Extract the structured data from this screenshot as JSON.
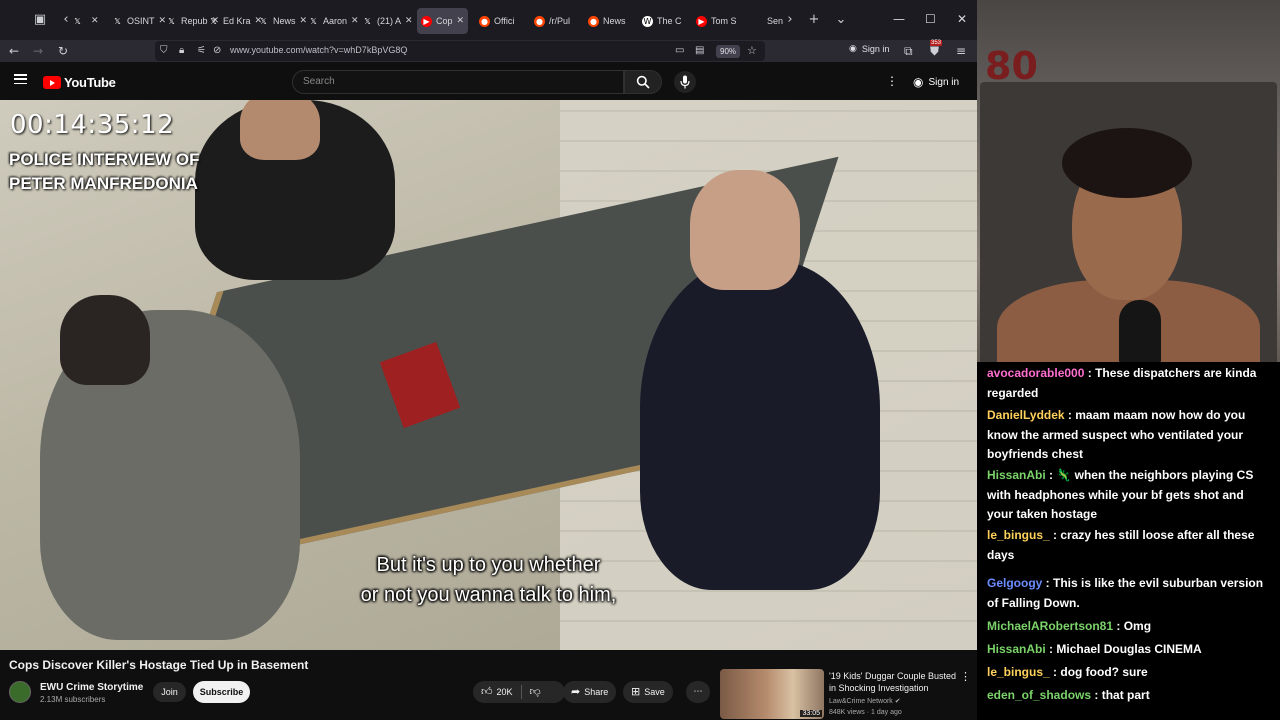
{
  "browser": {
    "tabs": [
      {
        "label": "",
        "icon": "x-logo-icon"
      },
      {
        "label": "OSINT",
        "icon": "x-logo-icon"
      },
      {
        "label": "Repub",
        "icon": "x-logo-icon"
      },
      {
        "label": "Ed Kra",
        "icon": "x-logo-icon"
      },
      {
        "label": "News",
        "icon": "x-logo-icon"
      },
      {
        "label": "Aaron",
        "icon": "x-logo-icon"
      },
      {
        "label": "(21) A",
        "icon": "x-logo-icon"
      },
      {
        "label": "Cop",
        "icon": "youtube-icon",
        "active": true
      },
      {
        "label": "Offici",
        "icon": "reddit-icon"
      },
      {
        "label": "/r/Pul",
        "icon": "reddit-icon"
      },
      {
        "label": "News",
        "icon": "reddit-icon"
      },
      {
        "label": "The C",
        "icon": "wikipedia-icon"
      },
      {
        "label": "Tom S",
        "icon": "youtube-icon"
      },
      {
        "label": "Sen",
        "icon": "page-icon"
      }
    ],
    "url": "www.youtube.com/watch?v=whD7kBpVG8Q",
    "zoom": "90%",
    "sign_in": "Sign in",
    "extension_badge": "353"
  },
  "youtube": {
    "logo": "YouTube",
    "search_placeholder": "Search",
    "sign_in": "Sign in"
  },
  "video": {
    "timecode": "00:14:35:12",
    "overlay_title_line1": "POLICE INTERVIEW OF",
    "overlay_title_line2": "PETER MANFREDONIA",
    "subtitle_line1": "But it's up to you whether",
    "subtitle_line2": "or not you wanna talk to him,"
  },
  "video_info": {
    "title": "Cops Discover Killer's Hostage Tied Up in Basement",
    "channel": "EWU Crime Storytime",
    "subscribers": "2.13M subscribers",
    "join": "Join",
    "subscribe": "Subscribe",
    "likes": "20K",
    "share": "Share",
    "save": "Save"
  },
  "recommendation": {
    "title": "'19 Kids' Duggar Couple Busted in Shocking Investigation",
    "channel": "Law&Crime Network",
    "meta": "848K views · 1 day ago",
    "duration": "33:05"
  },
  "webcam": {
    "sign_text": "80"
  },
  "chat": [
    {
      "user": "avocadorable000",
      "color": "#ff6fcf",
      "text": "These dispatchers are kinda regarded"
    },
    {
      "user": "DanielLyddek",
      "color": "#ffd15c",
      "text": "maam maam now how do you know the armed suspect who ventilated your boyfriends chest"
    },
    {
      "user": "HissanAbi",
      "color": "#7bd36a",
      "text": "🦎 when the neighbors playing CS with headphones while your bf gets shot and your taken hostage"
    },
    {
      "user": "le_bingus_",
      "color": "#ffd15c",
      "text": "crazy hes still loose after all these days"
    },
    {
      "user": "Gelgoogy",
      "color": "#6b8cff",
      "text": "This is like the evil suburban version of Falling Down."
    },
    {
      "user": "MichaelARobertson81",
      "color": "#7bd36a",
      "text": "Omg"
    },
    {
      "user": "HissanAbi",
      "color": "#7bd36a",
      "text": "Michael Douglas CINEMA"
    },
    {
      "user": "le_bingus_",
      "color": "#ffd15c",
      "text": "dog food? sure"
    },
    {
      "user": "eden_of_shadows",
      "color": "#7bd36a",
      "text": "that part"
    }
  ]
}
